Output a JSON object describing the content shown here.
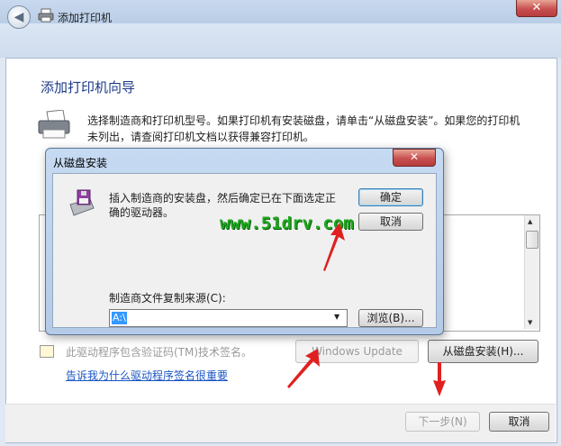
{
  "window": {
    "nav_title": "添加打印机",
    "close_glyph": "✕",
    "back_glyph": "◀"
  },
  "wizard": {
    "heading": "添加打印机向导",
    "instruction_line1": "选择制造商和打印机型号。如果打印机有安装磁盘，请单击“从磁盘安装”。如果您的打印机",
    "instruction_line2": "未列出，请查阅打印机文档以获得兼容打印机。",
    "cert_text": "此驱动程序包含验证码(TM)技术签名。",
    "sig_link": "告诉我为什么驱动程序签名很重要",
    "windows_update_label": "Windows Update",
    "have_disk_label": "从磁盘安装(H)...",
    "next_label": "下一步(N)",
    "cancel_label": "取消"
  },
  "dialog": {
    "title": "从磁盘安装",
    "close_glyph": "✕",
    "message_line1": "插入制造商的安装盘，然后确定已在下面选定正",
    "message_line2": "确的驱动器。",
    "ok_label": "确定",
    "cancel_label": "取消",
    "source_label": "制造商文件复制来源(C):",
    "source_value": "A:\\",
    "browse_label": "浏览(B)..."
  },
  "watermark": "www.51drv.com",
  "colors": {
    "heading": "#1c3a87",
    "link": "#1a55c4",
    "arrow": "#e02020",
    "watermark": "#1fa81f",
    "selection": "#3399ff"
  },
  "icons": [
    "back-arrow-icon",
    "printer-icon",
    "close-icon",
    "floppy-disk-icon",
    "certificate-icon",
    "dropdown-arrow-icon",
    "scroll-up-icon",
    "scroll-down-icon"
  ]
}
